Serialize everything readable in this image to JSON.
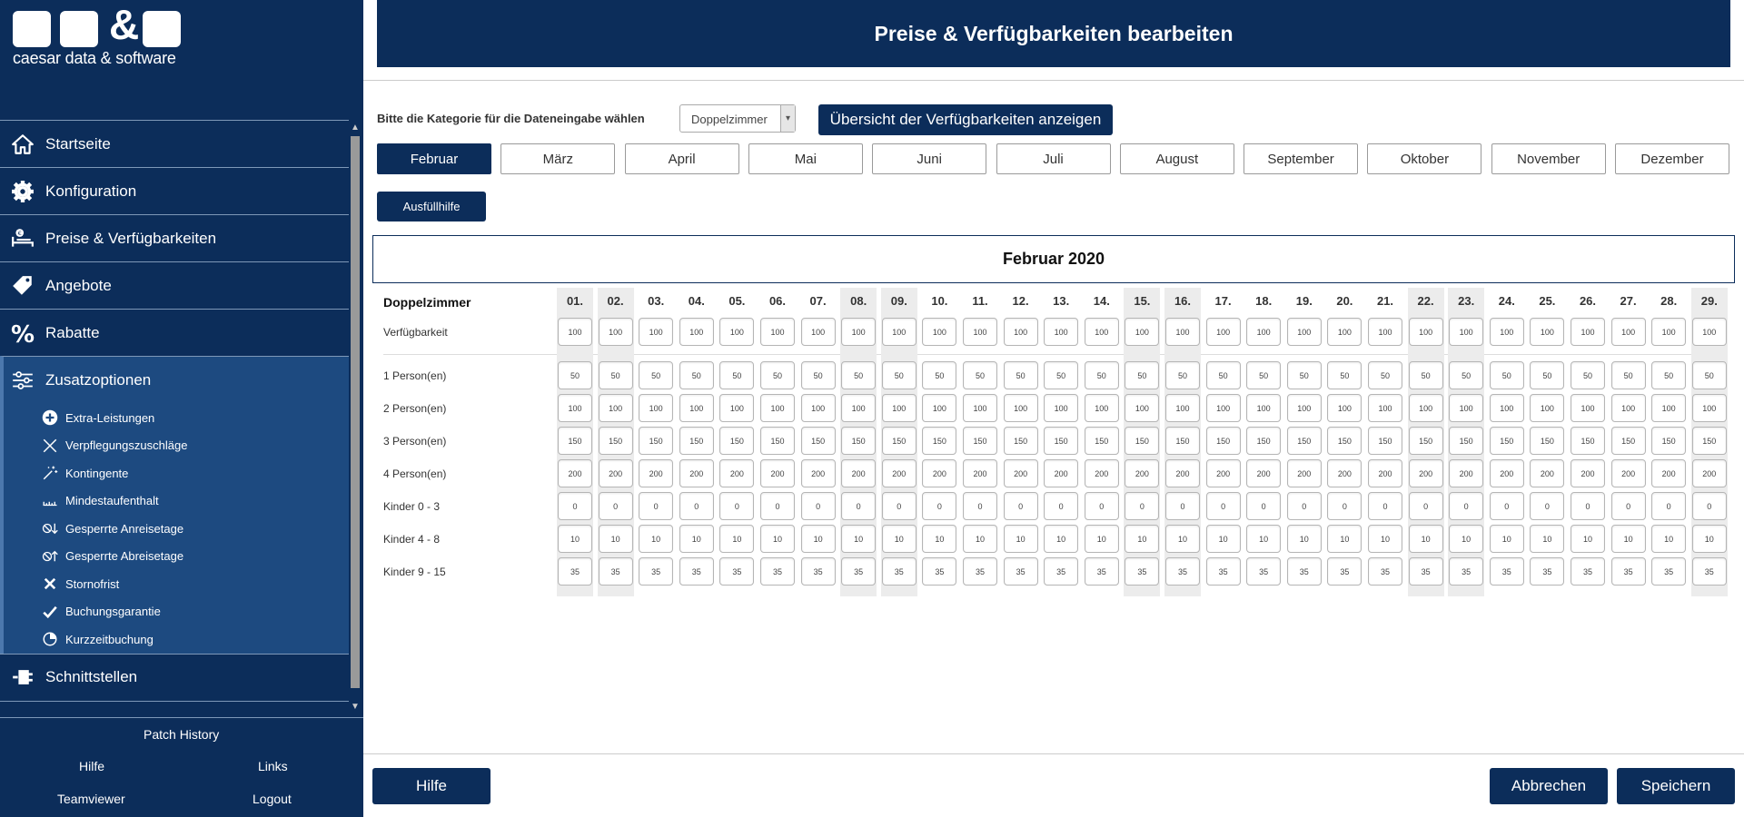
{
  "sidebar": {
    "logo_text": "caesar data & software",
    "logo_amp": "&",
    "nav": [
      {
        "label": "Startseite",
        "icon": "home-icon"
      },
      {
        "label": "Konfiguration",
        "icon": "gear-icon"
      },
      {
        "label": "Preise & Verfügbarkeiten",
        "icon": "bed-euro-icon"
      },
      {
        "label": "Angebote",
        "icon": "tag-icon"
      },
      {
        "label": "Rabatte",
        "icon": "percent-icon"
      }
    ],
    "group": {
      "label": "Zusatzoptionen",
      "icon": "sliders-icon",
      "items": [
        {
          "label": "Extra-Leistungen",
          "icon": "plus-circle-icon"
        },
        {
          "label": "Verpflegungszuschläge",
          "icon": "cutlery-icon"
        },
        {
          "label": "Kontingente",
          "icon": "wand-icon"
        },
        {
          "label": "Mindestaufenthalt",
          "icon": "ruler-icon"
        },
        {
          "label": "Gesperrte Anreisetage",
          "icon": "blocked-arrival-icon"
        },
        {
          "label": "Gesperrte Abreisetage",
          "icon": "blocked-departure-icon"
        },
        {
          "label": "Stornofrist",
          "icon": "x-icon"
        },
        {
          "label": "Buchungsgarantie",
          "icon": "check-icon"
        },
        {
          "label": "Kurzzeitbuchung",
          "icon": "pie-clock-icon"
        }
      ]
    },
    "after_group": [
      {
        "label": "Schnittstellen",
        "icon": "plug-icon"
      }
    ],
    "footer": {
      "patch_history": "Patch History",
      "hilfe": "Hilfe",
      "links": "Links",
      "teamviewer": "Teamviewer",
      "logout": "Logout"
    }
  },
  "header": {
    "title": "Preise & Verfügbarkeiten bearbeiten"
  },
  "category": {
    "label": "Bitte die Kategorie für die Dateneingabe wählen",
    "selected": "Doppelzimmer",
    "overview_button": "Übersicht der Verfügbarkeiten anzeigen"
  },
  "months": [
    "Februar",
    "März",
    "April",
    "Mai",
    "Juni",
    "Juli",
    "August",
    "September",
    "Oktober",
    "November",
    "Dezember"
  ],
  "active_month": "Februar",
  "fill_button": "Ausfüllhilfe",
  "calendar": {
    "title": "Februar 2020",
    "room": "Doppelzimmer",
    "days": [
      "01.",
      "02.",
      "03.",
      "04.",
      "05.",
      "06.",
      "07.",
      "08.",
      "09.",
      "10.",
      "11.",
      "12.",
      "13.",
      "14.",
      "15.",
      "16.",
      "17.",
      "18.",
      "19.",
      "20.",
      "21.",
      "22.",
      "23.",
      "24.",
      "25.",
      "26.",
      "27.",
      "28.",
      "29."
    ],
    "weekend_days": [
      "01.",
      "02.",
      "08.",
      "09.",
      "15.",
      "16.",
      "22.",
      "23.",
      "29."
    ],
    "availability_row": {
      "label": "Verfügbarkeit",
      "value": "100"
    },
    "price_rows": [
      {
        "label": "1 Person(en)",
        "value": "50"
      },
      {
        "label": "2 Person(en)",
        "value": "100"
      },
      {
        "label": "3 Person(en)",
        "value": "150"
      },
      {
        "label": "4 Person(en)",
        "value": "200"
      },
      {
        "label": "Kinder 0 - 3",
        "value": "0"
      },
      {
        "label": "Kinder 4 - 8",
        "value": "10"
      },
      {
        "label": "Kinder 9 - 15",
        "value": "35"
      }
    ]
  },
  "footer": {
    "help": "Hilfe",
    "cancel": "Abbrechen",
    "save": "Speichern"
  },
  "colors": {
    "primary": "#0c2d5a",
    "group_bg": "#1d4a80",
    "weekend_bg": "#ececec"
  }
}
